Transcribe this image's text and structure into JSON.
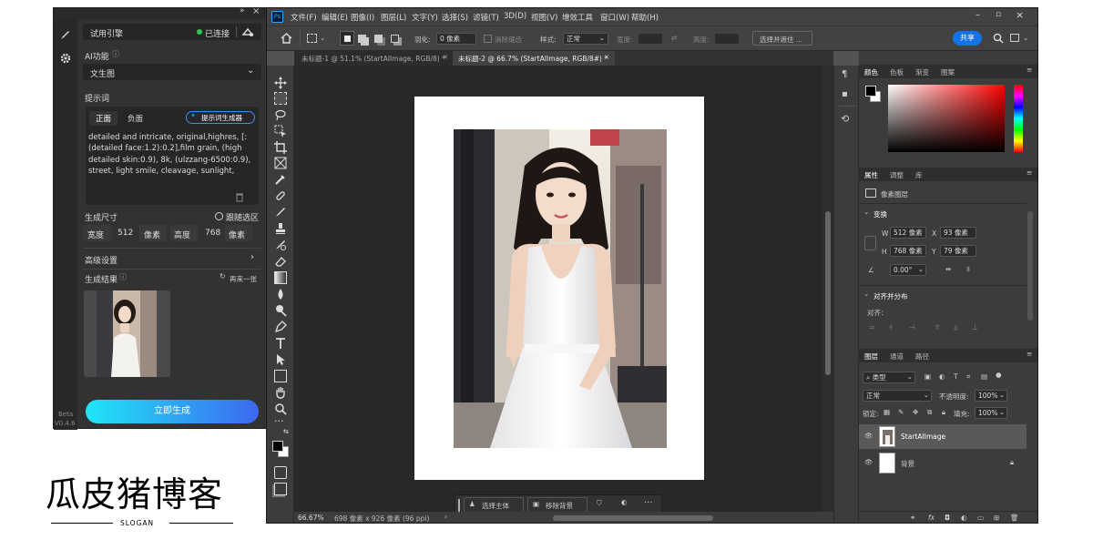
{
  "plugin": {
    "engine_label": "试用引擎",
    "connection_status": "已连接",
    "ai_function_label": "AI功能",
    "ai_function_value": "文生图",
    "prompt_section_label": "提示词",
    "tab_positive": "正面",
    "tab_negative": "负面",
    "prompt_generator_button": "提示词生成器",
    "prompt_text": "detailed and intricate, original,highres, [:(detailed face:1.2):0.2],film grain, (high detailed skin:0.9), 8k, (ulzzang-6500:0.9), street, light smile, cleavage, sunlight,",
    "size_label": "生成尺寸",
    "follow_selection_label": "跟随选区",
    "width_label": "宽度",
    "width_value": "512",
    "width_unit": "像素",
    "height_label": "高度",
    "height_value": "768",
    "height_unit": "像素",
    "advanced_label": "高级设置",
    "result_label": "生成结果",
    "regenerate_label": "再来一张",
    "version_label": "Beta",
    "version_number": "V0.4.6",
    "generate_button": "立即生成"
  },
  "logo": {
    "text": "瓜皮猪博客",
    "slogan": "SLOGAN"
  },
  "ps": {
    "menu": [
      "文件(F)",
      "编辑(E)",
      "图像(I)",
      "图层(L)",
      "文字(Y)",
      "选择(S)",
      "滤镜(T)",
      "3D(D)",
      "视图(V)",
      "增效工具",
      "窗口(W)",
      "帮助(H)"
    ],
    "options": {
      "feather_label": "羽化:",
      "feather_value": "0 像素",
      "antialias_label": "消除锯齿",
      "style_label": "样式:",
      "style_value": "正常",
      "width_label": "宽度:",
      "height_label": "高度:",
      "select_mask_button": "选择并遮住 ...",
      "share_button": "共享"
    },
    "tabs": [
      {
        "label": "未标题-1 @ 51.1% (StartAIImage, RGB/8) *"
      },
      {
        "label": "未标题-2 @ 66.7% (StartAIImage, RGB/8#) *"
      }
    ],
    "context_bar": {
      "select_subject": "选择主体",
      "remove_background": "移除背景"
    },
    "status": {
      "zoom": "66.67%",
      "doc_info": "698 像素 x 926 像素 (96 ppi)"
    },
    "color_panel_tabs": [
      "颜色",
      "色板",
      "渐变",
      "图案"
    ],
    "properties_tabs": [
      "属性",
      "调整",
      "库"
    ],
    "properties": {
      "layer_type": "像素图层",
      "transform_label": "变换",
      "w_label": "W",
      "w_value": "512 像素",
      "x_label": "X",
      "x_value": "93 像素",
      "h_label": "H",
      "h_value": "768 像素",
      "y_label": "Y",
      "y_value": "79 像素",
      "angle_value": "0.00°",
      "align_label": "对齐并分布",
      "align_sub": "对齐："
    },
    "layers_tabs": [
      "图层",
      "通道",
      "路径"
    ],
    "layers_panel": {
      "filter_value": "类型",
      "blend_mode": "正常",
      "opacity_label": "不透明度:",
      "opacity_value": "100%",
      "lock_label": "锁定:",
      "fill_label": "填充:",
      "fill_value": "100%",
      "layers": [
        {
          "name": "StartAIImage"
        },
        {
          "name": "背景"
        }
      ]
    }
  },
  "colors": {
    "accent_blue": "#1473e6",
    "status_green": "#33c24d",
    "generate_gradient_start": "#20e6f6",
    "generate_gradient_end": "#3c68f0"
  }
}
